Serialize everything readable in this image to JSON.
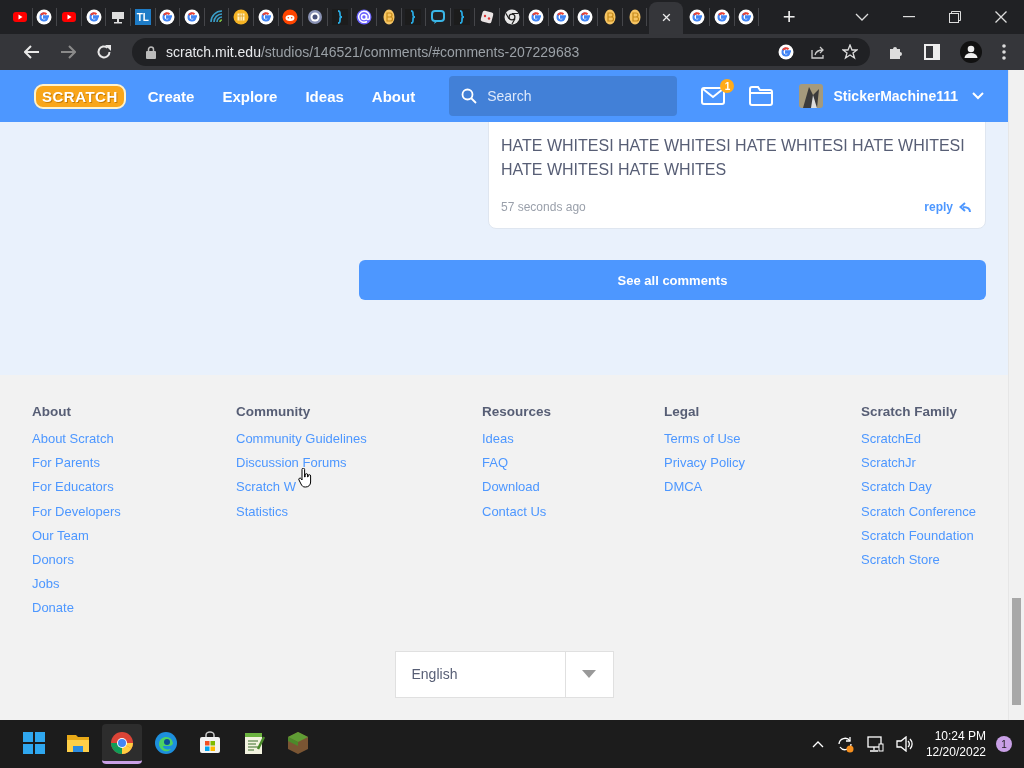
{
  "browser": {
    "tabs": [
      {
        "kind": "youtube",
        "selected": false
      },
      {
        "kind": "google",
        "selected": false
      },
      {
        "kind": "youtube",
        "selected": false
      },
      {
        "kind": "google",
        "selected": false
      },
      {
        "kind": "monitor",
        "selected": false
      },
      {
        "kind": "letters",
        "label": "TL",
        "selected": false
      },
      {
        "kind": "google",
        "selected": false
      },
      {
        "kind": "google",
        "selected": false
      },
      {
        "kind": "wave",
        "selected": false
      },
      {
        "kind": "calendar",
        "selected": false
      },
      {
        "kind": "google",
        "selected": false
      },
      {
        "kind": "reddit",
        "selected": false
      },
      {
        "kind": "ring",
        "selected": false
      },
      {
        "kind": "braces",
        "selected": false
      },
      {
        "kind": "at",
        "selected": false
      },
      {
        "kind": "sticker",
        "selected": false
      },
      {
        "kind": "braces",
        "selected": false
      },
      {
        "kind": "chat",
        "selected": false
      },
      {
        "kind": "braces",
        "selected": false
      },
      {
        "kind": "dice",
        "selected": false
      },
      {
        "kind": "chrome",
        "selected": false
      },
      {
        "kind": "google",
        "selected": false
      },
      {
        "kind": "google",
        "selected": false
      },
      {
        "kind": "google",
        "selected": false
      },
      {
        "kind": "sticker",
        "selected": false
      },
      {
        "kind": "sticker",
        "selected": false
      },
      {
        "kind": "close",
        "label": "×",
        "selected": true
      },
      {
        "kind": "google",
        "selected": false
      },
      {
        "kind": "google",
        "selected": false
      },
      {
        "kind": "google",
        "selected": false
      }
    ],
    "new_tab": "+",
    "address": {
      "host": "scratch.mit.edu",
      "path": "/studios/146521/comments/#comments-207229683"
    }
  },
  "header": {
    "logo": "SCRATCH",
    "nav": [
      "Create",
      "Explore",
      "Ideas",
      "About"
    ],
    "search": {
      "placeholder": "Search"
    },
    "messages_badge": "1",
    "username": "StickerMachine111"
  },
  "comment": {
    "text": "HATE WHITESI HATE WHITESI HATE WHITESI HATE WHITESI HATE WHITESI HATE WHITES",
    "time": "57 seconds ago",
    "reply": "reply"
  },
  "see_all": "See all comments",
  "footer": {
    "columns": [
      {
        "heading": "About",
        "links": [
          "About Scratch",
          "For Parents",
          "For Educators",
          "For Developers",
          "Our Team",
          "Donors",
          "Jobs",
          "Donate"
        ]
      },
      {
        "heading": "Community",
        "links": [
          "Community Guidelines",
          "Discussion Forums",
          "Scratch W",
          "Statistics"
        ]
      },
      {
        "heading": "Resources",
        "links": [
          "Ideas",
          "FAQ",
          "Download",
          "Contact Us"
        ]
      },
      {
        "heading": "Legal",
        "links": [
          "Terms of Use",
          "Privacy Policy",
          "DMCA"
        ]
      },
      {
        "heading": "Scratch Family",
        "links": [
          "ScratchEd",
          "ScratchJr",
          "Scratch Day",
          "Scratch Conference",
          "Scratch Foundation",
          "Scratch Store"
        ]
      }
    ],
    "language": "English"
  },
  "taskbar": {
    "apps": [
      {
        "kind": "start",
        "selected": false
      },
      {
        "kind": "folder",
        "selected": false
      },
      {
        "kind": "chrome",
        "selected": true
      },
      {
        "kind": "edge",
        "selected": false
      },
      {
        "kind": "store",
        "selected": false
      },
      {
        "kind": "notepad",
        "selected": false
      },
      {
        "kind": "block",
        "selected": false
      }
    ],
    "time": "10:24 PM",
    "date": "12/20/2022",
    "notifications": "1"
  }
}
